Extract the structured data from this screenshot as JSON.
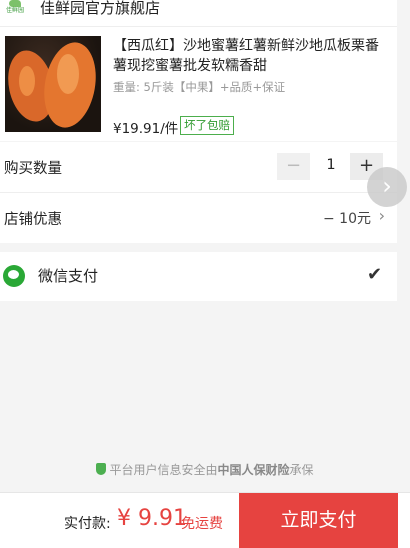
{
  "store": {
    "logo_text": "佳鲜园",
    "name": "佳鲜园官方旗舰店"
  },
  "product": {
    "title": "【西瓜红】沙地蜜薯红薯新鲜沙地瓜板栗番薯现挖蜜薯批发软糯香甜",
    "spec": "重量: 5斤装【中果】+品质+保证",
    "price": "¥19.91/件",
    "badge": "坏了包赔"
  },
  "quantity": {
    "label": "购买数量",
    "minus": "−",
    "value": "1",
    "plus": "+"
  },
  "coupon": {
    "label": "店铺优惠",
    "value": "− 10元"
  },
  "payment": {
    "label": "微信支付"
  },
  "security": {
    "prefix": "平台用户信息安全由",
    "brand": "中国人保财险",
    "suffix": "承保"
  },
  "footer": {
    "total_label": "实付款:",
    "total_value": "¥ 9.91",
    "shipping": "免运费",
    "pay_button": "立即支付"
  },
  "colors": {
    "accent": "#e64340",
    "wechat_green": "#2aa836",
    "badge_green": "#2f9a2f"
  }
}
